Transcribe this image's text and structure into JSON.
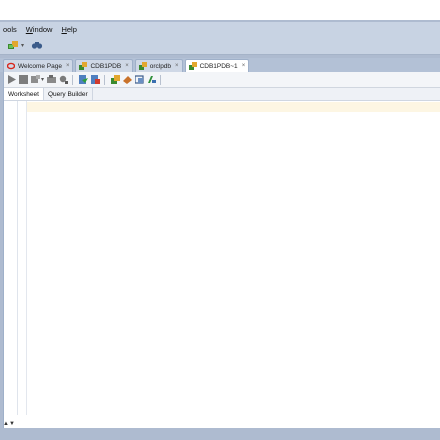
{
  "menu": {
    "items": [
      {
        "label": "ools",
        "underline": ""
      },
      {
        "label": "Window",
        "underline": "W"
      },
      {
        "label": "Help",
        "underline": "H"
      }
    ]
  },
  "main_toolbar": {
    "icons": [
      "connection-add-icon",
      "dropdown-arrow-icon",
      "binoculars-icon"
    ]
  },
  "tabs": [
    {
      "label": "Welcome Page",
      "icon": "oracle-icon",
      "active": false
    },
    {
      "label": "CDB1PDB",
      "icon": "db-connection-icon",
      "active": false
    },
    {
      "label": "orclpdb",
      "icon": "db-connection-icon",
      "active": false
    },
    {
      "label": "CDB1PDB~1",
      "icon": "db-connection-icon",
      "active": true
    }
  ],
  "subtabs": [
    {
      "label": "Worksheet",
      "active": true
    },
    {
      "label": "Query Builder",
      "active": false
    }
  ],
  "colors": {
    "frame": "#aebbd0",
    "menubar": "#c8d3e3",
    "current_line": "#fdf6e3"
  }
}
